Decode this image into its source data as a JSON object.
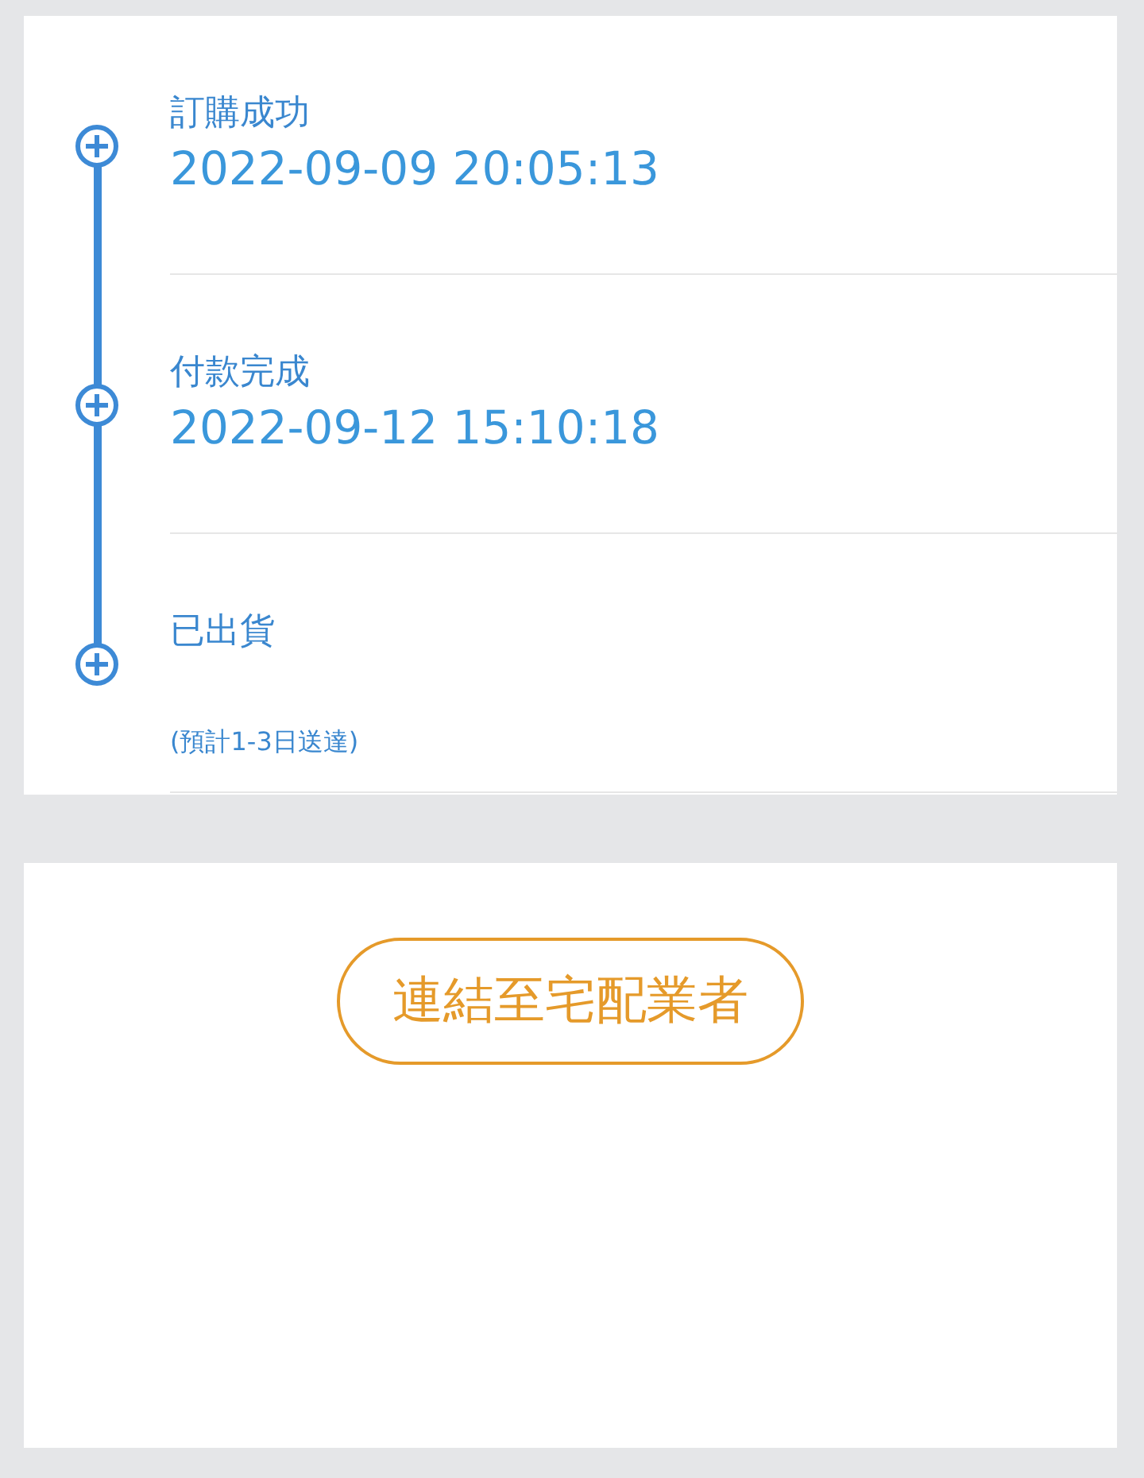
{
  "timeline": [
    {
      "label": "訂購成功",
      "time": "2022-09-09 20:05:13"
    },
    {
      "label": "付款完成",
      "time": "2022-09-12 15:10:18"
    },
    {
      "label": "已出貨",
      "note": "(預計1-3日送達)"
    }
  ],
  "button": {
    "label": "連結至宅配業者"
  }
}
